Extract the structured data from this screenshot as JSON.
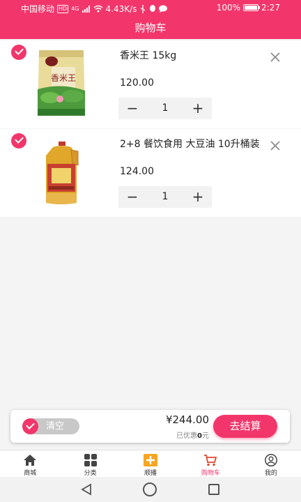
{
  "status_bar": {
    "carrier": "中国移动",
    "network_badge": "HD",
    "signal": "4G",
    "speed": "4.43K/s",
    "battery_percent": "100%",
    "time": "2:27",
    "icons": [
      "signal-icon",
      "wifi-icon",
      "usb-icon",
      "qq-icon",
      "message-icon",
      "battery-icon"
    ]
  },
  "header": {
    "title": "购物车"
  },
  "cart": {
    "items": [
      {
        "name": "香米王 15kg",
        "price": "120.00",
        "quantity": "1",
        "checked": true,
        "image_label": "香米王",
        "decrement": "−",
        "increment": "+",
        "remove_icon": "close-icon"
      },
      {
        "name": "2+8 餐饮食用 大豆油 10升桶装",
        "price": "124.00",
        "quantity": "1",
        "checked": true,
        "image_label": "",
        "decrement": "−",
        "increment": "+",
        "remove_icon": "close-icon"
      }
    ]
  },
  "checkout": {
    "select_all_checked": true,
    "clear_label": "清空",
    "total": "¥244.00",
    "discount_prefix": "已优惠",
    "discount_amount": "0",
    "discount_suffix": "元",
    "pay_label": "去结算"
  },
  "tabbar": {
    "items": [
      {
        "label": "商城",
        "icon": "home-icon",
        "active": false
      },
      {
        "label": "分类",
        "icon": "category-grid-icon",
        "active": false
      },
      {
        "label": "顺播",
        "icon": "plus-box-icon",
        "active": false
      },
      {
        "label": "购物车",
        "icon": "cart-icon",
        "active": true
      },
      {
        "label": "我的",
        "icon": "user-icon",
        "active": false
      }
    ]
  },
  "colors": {
    "accent": "#f2366b",
    "tab_plus_box": "#f5a623",
    "background": "#f4f4f4"
  }
}
